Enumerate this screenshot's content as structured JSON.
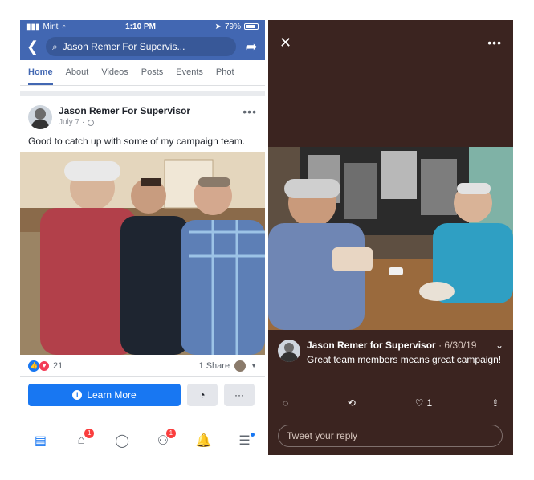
{
  "colors": {
    "facebook_blue": "#4267b2",
    "twitter_brown": "#3b2420",
    "button_blue": "#1877f2",
    "badge_red": "#fa3e3e"
  },
  "facebook": {
    "status_bar": {
      "carrier": "Mint",
      "time": "1:10 PM",
      "battery": "79%"
    },
    "nav": {
      "back_icon": "back-chevron-icon",
      "search_text": "Jason Remer For Supervis...",
      "share_icon": "share-arrow-icon"
    },
    "tabs": [
      {
        "label": "Home"
      },
      {
        "label": "About"
      },
      {
        "label": "Videos"
      },
      {
        "label": "Posts"
      },
      {
        "label": "Events"
      },
      {
        "label": "Phot"
      }
    ],
    "post": {
      "author": "Jason Remer For Supervisor",
      "date": "July 7 ·",
      "text": "Good to catch up with some of my campaign team."
    },
    "reactions": {
      "count": "21",
      "shares": "1 Share"
    },
    "cta": {
      "learn_more": "Learn More",
      "more": "···"
    },
    "bottom_nav": {
      "badge_marketplace": "1",
      "badge_groups": "1"
    }
  },
  "twitter": {
    "top": {
      "close": "✕",
      "more": "•••"
    },
    "tweet": {
      "author": "Jason Remer for Supervisor",
      "date": " · 6/30/19",
      "text": "Great team members means great campaign!"
    },
    "actions": {
      "like_count": "1"
    },
    "reply_placeholder": "Tweet your reply"
  }
}
